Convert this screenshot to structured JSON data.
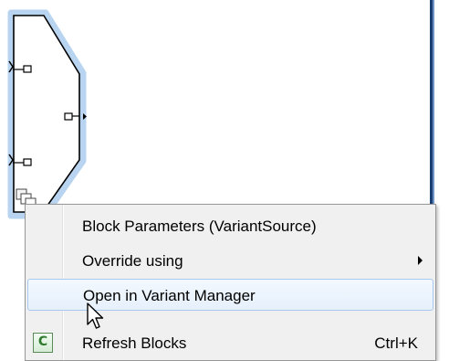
{
  "context_menu": {
    "items": [
      {
        "label": "Block Parameters (VariantSource)",
        "shortcut": "",
        "has_submenu": false,
        "highlighted": false
      },
      {
        "label": "Override using",
        "shortcut": "",
        "has_submenu": true,
        "highlighted": false
      },
      {
        "label": "Open in Variant Manager",
        "shortcut": "",
        "has_submenu": false,
        "highlighted": true
      },
      {
        "label": "Refresh Blocks",
        "shortcut": "Ctrl+K",
        "has_submenu": false,
        "highlighted": false,
        "icon": "refresh-icon",
        "icon_glyph": "C"
      }
    ]
  },
  "colors": {
    "block_selection": "#b8d4f0",
    "menu_background": "#f0f0f0",
    "menu_highlight": "#e6f0fb",
    "menu_highlight_border": "#a8c8ee"
  }
}
